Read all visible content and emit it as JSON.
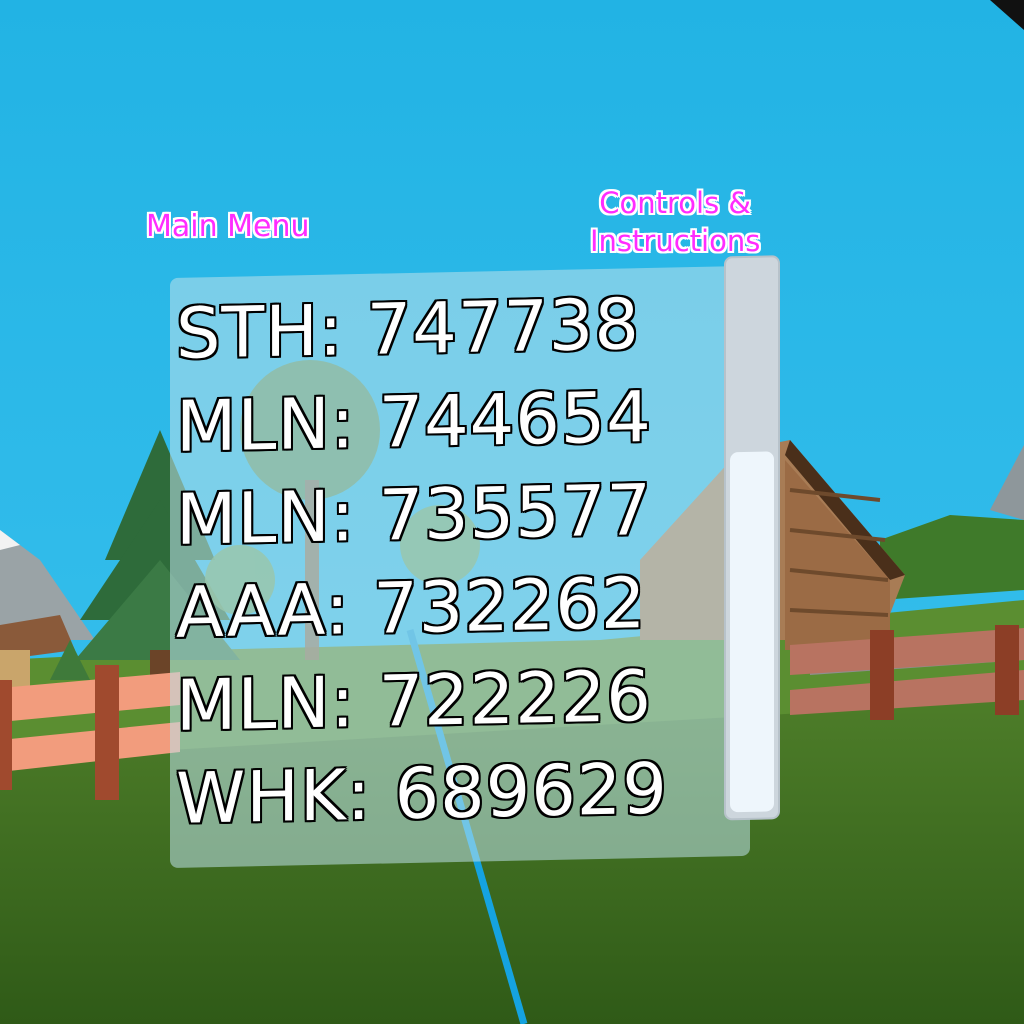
{
  "hud": {
    "main_menu_label": "Main Menu",
    "controls_label_line1": "Controls &",
    "controls_label_line2": "Instructions"
  },
  "leaderboard": {
    "scores": [
      {
        "text": "STH: 747738"
      },
      {
        "text": "MLN: 744654"
      },
      {
        "text": "MLN: 735577"
      },
      {
        "text": "AAA: 732262"
      },
      {
        "text": "MLN: 722226"
      },
      {
        "text": "WHK: 689629"
      }
    ],
    "scroll_position": 0.35
  },
  "colors": {
    "sky": "#25b6e6",
    "grass": "#3e6e1f",
    "menu_text": "#ff2cff",
    "pointer_ray": "#15a3e0"
  }
}
